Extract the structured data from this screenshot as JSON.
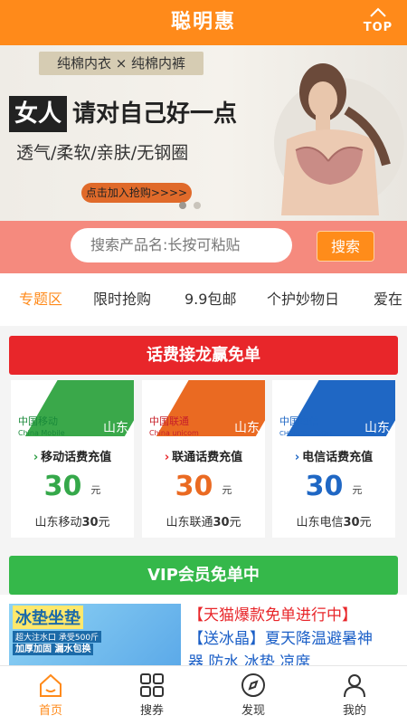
{
  "header": {
    "title": "聪明惠",
    "top_label": "TOP"
  },
  "banner": {
    "tag": "纯棉内衣 × 纯棉内裤",
    "headline_box": "女人",
    "headline_rest": "请对自己好一点",
    "features": "透气/柔软/亲肤/无钢圈",
    "cta": "点击加入抢购>>>>"
  },
  "search": {
    "placeholder": "搜索产品名:长按可粘贴",
    "button": "搜索"
  },
  "tabs": [
    "专题区",
    "限时抢购",
    "9.9包邮",
    "个护妙物日",
    "爱在"
  ],
  "section1": {
    "title": "话费接龙赢免单"
  },
  "cards": [
    {
      "brand_cn": "中国移动",
      "brand_en": "China Mobile",
      "province": "山东",
      "label": "移动话费充值",
      "price": "30",
      "unit": "元",
      "sub_prefix": "山东移动",
      "sub_num": "30",
      "sub_suffix": "元",
      "color": "#3aa84a",
      "price_color": "#35a84a",
      "chev_color": "#2f9e45"
    },
    {
      "brand_cn": "中国联通",
      "brand_en": "China unicom",
      "province": "山东",
      "label": "联通话费充值",
      "price": "30",
      "unit": "元",
      "sub_prefix": "山东联通",
      "sub_num": "30",
      "sub_suffix": "元",
      "color": "#ea6a22",
      "price_color": "#ea6a22",
      "chev_color": "#e8262a"
    },
    {
      "brand_cn": "中国电信",
      "brand_en": "CHINA TELECOM",
      "province": "山东",
      "label": "电信话费充值",
      "price": "30",
      "unit": "元",
      "sub_prefix": "山东电信",
      "sub_num": "30",
      "sub_suffix": "元",
      "color": "#1f67c4",
      "price_color": "#1f67c4",
      "chev_color": "#1f67c4"
    }
  ],
  "section2": {
    "title": "VIP会员免单中"
  },
  "promo": {
    "img_title": "冰垫坐垫",
    "img_sub": "超大注水口 承受500斤",
    "img_sub2": "加厚加固 漏水包换",
    "line1": "【天猫爆款免单进行中】",
    "line2": "【送冰晶】夏天降温避暑神",
    "line3": "器 防水 冰垫 凉席"
  },
  "bottom_nav": [
    {
      "label": "首页",
      "icon": "home-icon"
    },
    {
      "label": "搜券",
      "icon": "grid-icon"
    },
    {
      "label": "发现",
      "icon": "compass-icon"
    },
    {
      "label": "我的",
      "icon": "user-icon"
    }
  ],
  "colors": {
    "accent": "#ff8a1a",
    "red_section": "#e8262a",
    "green_section": "#35b84a"
  }
}
